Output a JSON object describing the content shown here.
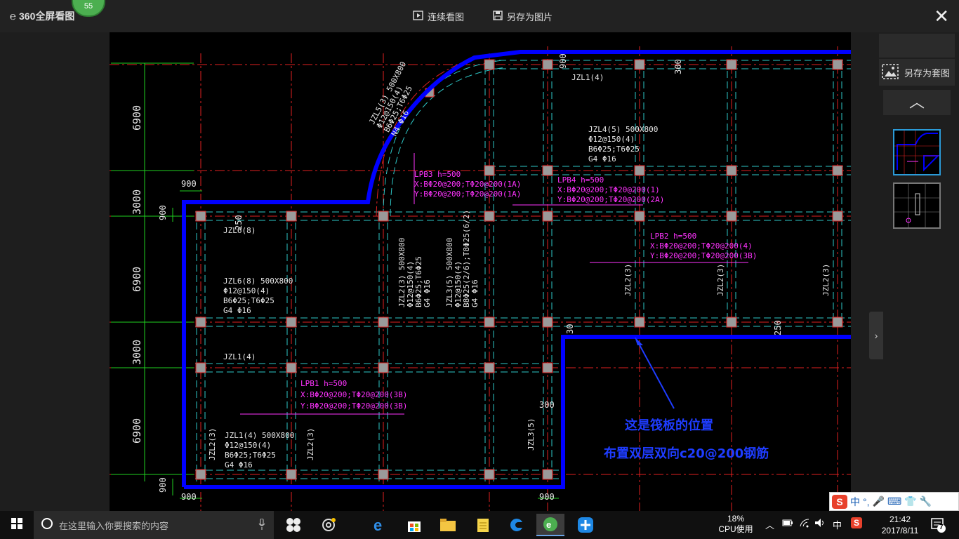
{
  "app": {
    "name": "360全屏看图",
    "badge": "55",
    "continuous_view": "连续看图",
    "save_as_image": "另存为图片",
    "save_as_set": "另存为套图",
    "close": "✕"
  },
  "drawing": {
    "annotation_line1": "这是筏板的位置",
    "annotation_line2": "布置双层双向c20@200钢筋",
    "dims_left": [
      "6900",
      "3000",
      "6900",
      "3000",
      "6900"
    ],
    "dim_900": "900",
    "dim_300": "300",
    "dim_250": "250",
    "dim_30": "30",
    "beams": {
      "jzl6_a": "JZL6(8)",
      "jzl6_b": [
        "JZL6(8)  500X800",
        "Φ12@150(4)",
        "B6Φ25;T6Φ25",
        "G4 Φ16"
      ],
      "jzl1_a": "JZL1(4)",
      "jzl1_b": [
        "JZL1(4)  500X800",
        "Φ12@150(4)",
        "B6Φ25;T6Φ25",
        "G4 Φ16"
      ],
      "jzl4": [
        "JZL4(5)  500X800",
        "Φ12@150(4)",
        "B6Φ25;T6Φ25",
        "G4 Φ16"
      ],
      "jzl5": [
        "JZL5(3)  500X800",
        "Φ12@150(4)",
        "B6Φ25;T6Φ25",
        "N4 Φ16"
      ],
      "jzl1_top": "JZL1(4)",
      "jzl2": [
        "JZL2(3)  500X800",
        "Φ12@150(4)",
        "B6Φ25;T6Φ25",
        "G4 Φ16"
      ],
      "jzl3": [
        "JZL3(5)  500X800",
        "Φ12@150(4)",
        "B8Φ25(2/6);T8Φ25(6/2)",
        "G4 Φ16"
      ],
      "jzl2_v": "JZL2(3)",
      "jzl3_v": "JZL3(5)"
    },
    "slabs": {
      "lpb1": [
        "LPB1  h=500",
        "X:BΦ20@200;TΦ20@200(3B)",
        "Y:BΦ20@200;TΦ20@200(3B)"
      ],
      "lpb2": [
        "LPB2  h=500",
        "X:BΦ20@200;TΦ20@200(4)",
        "Y:BΦ20@200;TΦ20@200(3B)"
      ],
      "lpb3": [
        "LPB3  h=500",
        "X:BΦ20@200;TΦ20@200(1A)",
        "Y:BΦ20@200;TΦ20@200(1A)"
      ],
      "lpb4": [
        "LPB4  h=500",
        "X:BΦ20@200;TΦ20@200(1)",
        "Y:BΦ20@200;TΦ20@200(2A)"
      ]
    }
  },
  "sidebar": {
    "up": "︿",
    "next": "›"
  },
  "taskbar": {
    "search_placeholder": "在这里输入你要搜索的内容",
    "cpu_percent": "18%",
    "cpu_label": "CPU使用",
    "ime_lang": "中",
    "ime_s": "S",
    "time": "21:42",
    "date": "2017/8/11",
    "notif_count": "7",
    "ime_bar": [
      "中",
      "°,",
      "🎤",
      "⌨",
      "👕",
      "🔧"
    ]
  },
  "colors": {
    "accent_blue": "#0000ff",
    "grid_red": "#e02020",
    "grid_cyan": "#2ec7c7",
    "dim_green": "#1fd11f",
    "label_magenta": "#ff33ff",
    "annotation_blue": "#1e3cff"
  }
}
